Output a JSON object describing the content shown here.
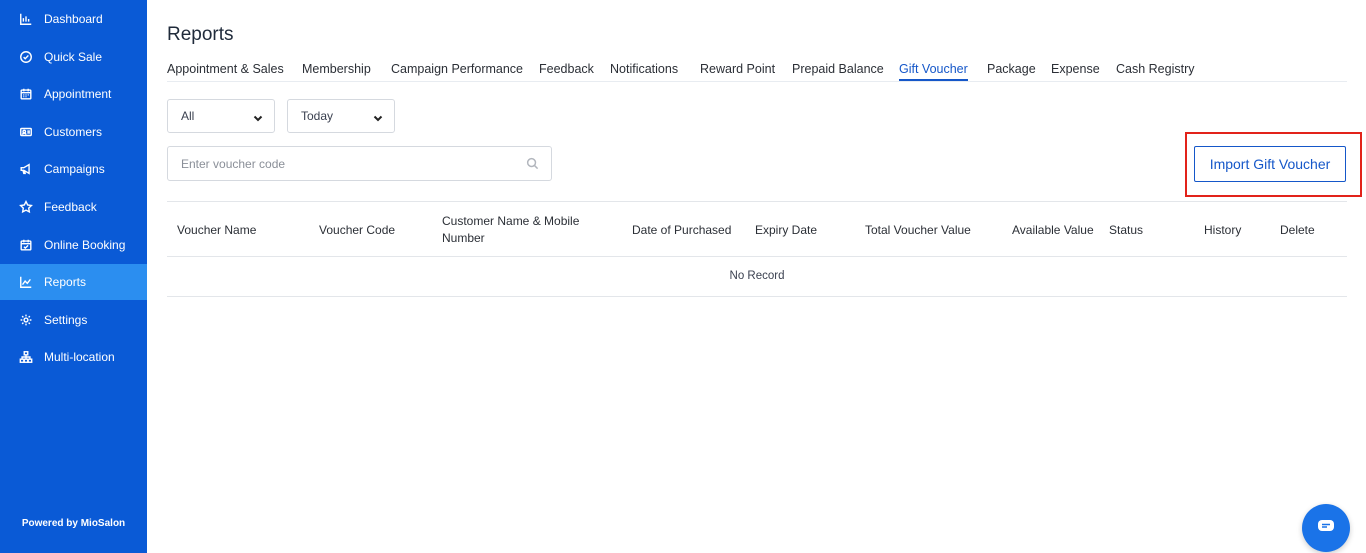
{
  "sidebar": {
    "items": [
      {
        "label": "Dashboard",
        "icon": "bar-chart-icon"
      },
      {
        "label": "Quick Sale",
        "icon": "check-circle-icon"
      },
      {
        "label": "Appointment",
        "icon": "calendar-icon"
      },
      {
        "label": "Customers",
        "icon": "users-icon"
      },
      {
        "label": "Campaigns",
        "icon": "megaphone-icon"
      },
      {
        "label": "Feedback",
        "icon": "star-icon"
      },
      {
        "label": "Online Booking",
        "icon": "calendar-check-icon"
      },
      {
        "label": "Reports",
        "icon": "line-chart-icon",
        "active": true
      },
      {
        "label": "Settings",
        "icon": "gear-icon"
      },
      {
        "label": "Multi-location",
        "icon": "sitemap-icon"
      }
    ],
    "powered_by": "Powered by MioSalon"
  },
  "page": {
    "title": "Reports"
  },
  "tabs": [
    {
      "label": "Appointment & Sales"
    },
    {
      "label": "Membership"
    },
    {
      "label": "Campaign Performance"
    },
    {
      "label": "Feedback"
    },
    {
      "label": "Notifications"
    },
    {
      "label": "Reward Point"
    },
    {
      "label": "Prepaid Balance"
    },
    {
      "label": "Gift Voucher",
      "active": true
    },
    {
      "label": "Package"
    },
    {
      "label": "Expense"
    },
    {
      "label": "Cash Registry"
    }
  ],
  "filters": {
    "type_value": "All",
    "date_value": "Today"
  },
  "search": {
    "placeholder": "Enter voucher code"
  },
  "actions": {
    "import_label": "Import Gift Voucher"
  },
  "table": {
    "columns": [
      "Voucher Name",
      "Voucher Code",
      "Customer Name & Mobile Number",
      "Date of Purchased",
      "Expiry Date",
      "Total Voucher Value",
      "Available Value",
      "Status",
      "History",
      "Delete"
    ],
    "empty_text": "No Record"
  },
  "colors": {
    "sidebar_bg": "#0a5ad6",
    "sidebar_active": "#2b8ef0",
    "accent": "#1557c9",
    "highlight": "#e2231a"
  }
}
